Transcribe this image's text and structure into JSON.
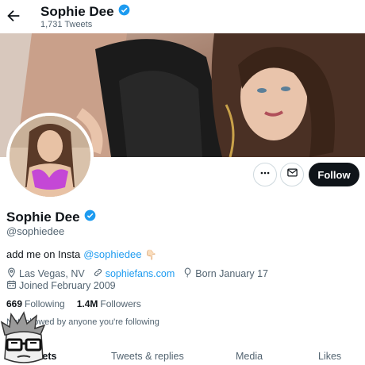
{
  "header": {
    "name": "Sophie Dee",
    "tweet_count": "1,731 Tweets",
    "back_icon": "arrow-left-icon",
    "verified_icon": "verified-badge-icon"
  },
  "actions": {
    "more_icon": "more-horizontal-icon",
    "message_icon": "mail-icon",
    "follow_label": "Follow"
  },
  "profile": {
    "display_name": "Sophie Dee",
    "handle": "@sophiedee",
    "bio_text": "add me on Insta",
    "bio_link": "@sophiedee",
    "bio_emoji": "👇🏻",
    "location": "Las Vegas, NV",
    "website": "sophiefans.com",
    "birthday": "Born January 17",
    "joined": "Joined February 2009"
  },
  "stats": {
    "following_count": "669",
    "following_label": "Following",
    "followers_count": "1.4M",
    "followers_label": "Followers"
  },
  "notice": "Not followed by anyone you're following",
  "tabs": [
    {
      "label": "Tweets",
      "active": true
    },
    {
      "label": "Tweets & replies",
      "active": false
    },
    {
      "label": "Media",
      "active": false
    },
    {
      "label": "Likes",
      "active": false
    }
  ],
  "colors": {
    "accent": "#1d9bf0",
    "text": "#0f1419",
    "secondary": "#536471",
    "follow_bg": "#0f1419"
  }
}
